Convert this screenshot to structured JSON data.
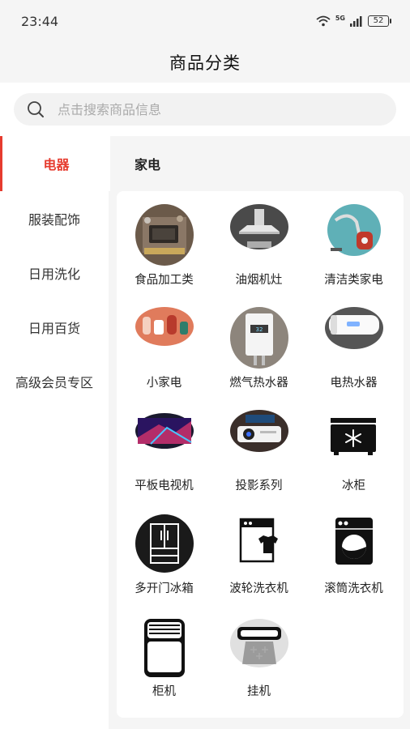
{
  "status": {
    "time": "23:44",
    "network": "5G",
    "battery": "52"
  },
  "header": {
    "title": "商品分类"
  },
  "search": {
    "placeholder": "点击搜索商品信息"
  },
  "top_tabs": [
    {
      "label": "电器",
      "active": true
    },
    {
      "label": "家电",
      "active": false
    }
  ],
  "side_menu": [
    {
      "label": "服装配饰"
    },
    {
      "label": "日用洗化"
    },
    {
      "label": "日用百货"
    },
    {
      "label": "高级会员专区"
    }
  ],
  "categories": [
    {
      "label": "食品加工类",
      "icon": "food-processor-photo"
    },
    {
      "label": "油烟机灶",
      "icon": "range-hood-photo"
    },
    {
      "label": "清洁类家电",
      "icon": "vacuum-cleaner-photo"
    },
    {
      "label": "小家电",
      "icon": "small-appliances-photo"
    },
    {
      "label": "燃气热水器",
      "icon": "gas-water-heater-photo"
    },
    {
      "label": "电热水器",
      "icon": "electric-water-heater-photo"
    },
    {
      "label": "平板电视机",
      "icon": "flat-tv-photo"
    },
    {
      "label": "投影系列",
      "icon": "projector-photo"
    },
    {
      "label": "冰柜",
      "icon": "freezer-icon"
    },
    {
      "label": "多开门冰箱",
      "icon": "multi-door-fridge-icon"
    },
    {
      "label": "波轮洗衣机",
      "icon": "top-load-washer-icon"
    },
    {
      "label": "滚筒洗衣机",
      "icon": "front-load-washer-icon"
    },
    {
      "label": "柜机",
      "icon": "floor-ac-icon"
    },
    {
      "label": "挂机",
      "icon": "wall-ac-icon"
    }
  ],
  "colors": {
    "accent": "#e63b2e",
    "background": "#f5f5f5",
    "panel": "#ffffff"
  }
}
